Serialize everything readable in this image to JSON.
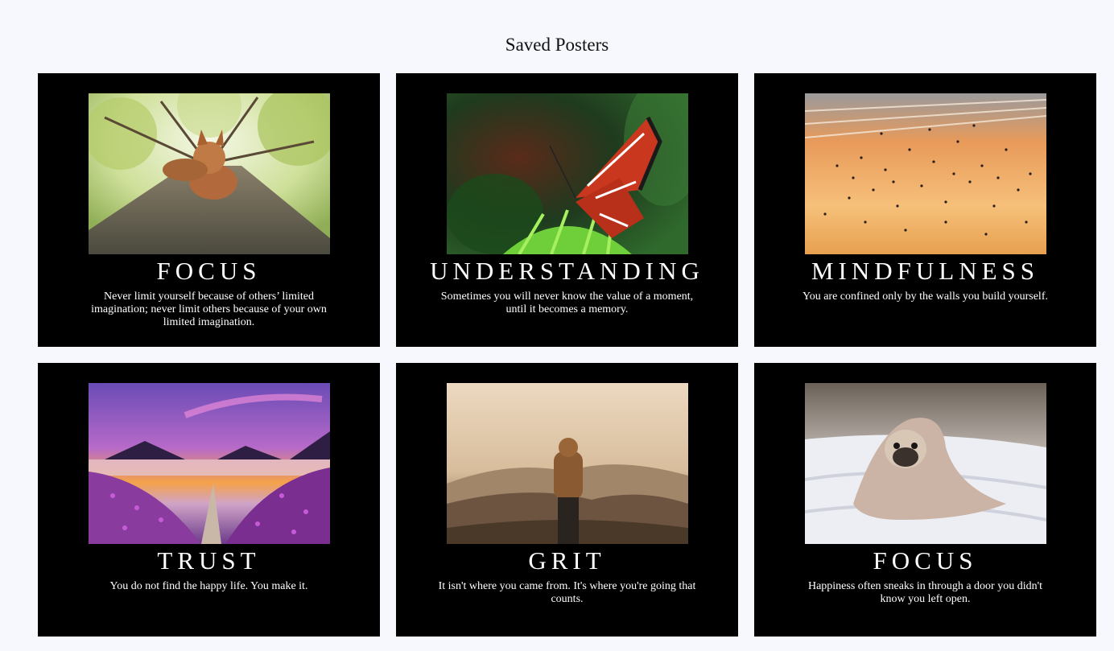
{
  "page": {
    "title": "Saved Posters"
  },
  "posters": [
    {
      "title": "FOCUS",
      "quote": "Never limit yourself because of others’ limited imagination; never limit others because of your own limited imagination.",
      "image": "squirrel-on-tree-photo"
    },
    {
      "title": "UNDERSTANDING",
      "quote": "Sometimes you will never know the value of a moment, until it becomes a memory.",
      "image": "butterfly-on-fern-photo"
    },
    {
      "title": "MINDFULNESS",
      "quote": "You are confined only by the walls you build yourself.",
      "image": "bird-flock-sunset-photo"
    },
    {
      "title": "TRUST",
      "quote": "You do not find the happy life. You make it.",
      "image": "lavender-path-lake-photo"
    },
    {
      "title": "GRIT",
      "quote": "It isn't where you came from. It's where you're going that counts.",
      "image": "hooded-person-mountains-photo"
    },
    {
      "title": "FOCUS",
      "quote": "Happiness often sneaks in through a door you didn't know you left open.",
      "image": "pug-in-blanket-photo"
    }
  ]
}
